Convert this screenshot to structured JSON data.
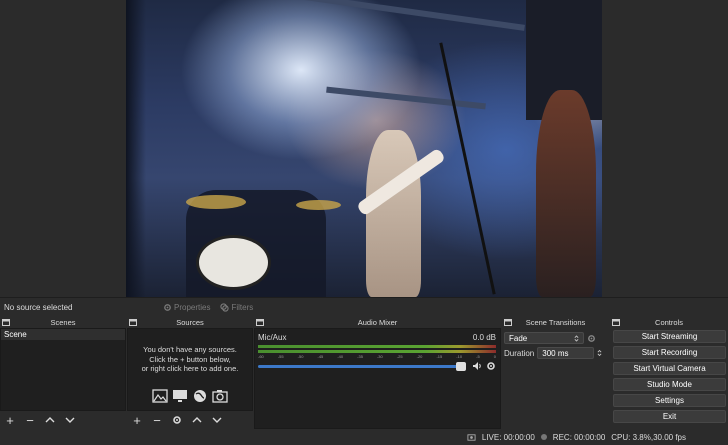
{
  "preview": {
    "scene_caption": ""
  },
  "source_bar": {
    "no_source": "No source selected",
    "properties_label": "Properties",
    "filters_label": "Filters"
  },
  "docks": {
    "scenes": {
      "title": "Scenes",
      "items": [
        "Scene"
      ]
    },
    "sources": {
      "title": "Sources",
      "empty_line1": "You don't have any sources.",
      "empty_line2": "Click the + button below,",
      "empty_line3": "or right click here to add one."
    },
    "mixer": {
      "title": "Audio Mixer",
      "channel_name": "Mic/Aux",
      "channel_db": "0.0 dB",
      "scale": [
        "-60",
        "-55",
        "-50",
        "-45",
        "-40",
        "-35",
        "-30",
        "-25",
        "-20",
        "-15",
        "-10",
        "-5",
        "0"
      ]
    },
    "transitions": {
      "title": "Scene Transitions",
      "selected": "Fade",
      "duration_label": "Duration",
      "duration_value": "300 ms"
    },
    "controls": {
      "title": "Controls",
      "buttons": [
        "Start Streaming",
        "Start Recording",
        "Start Virtual Camera",
        "Studio Mode",
        "Settings",
        "Exit"
      ]
    }
  },
  "status": {
    "live": "LIVE: 00:00:00",
    "rec": "REC: 00:00:00",
    "cpu": "CPU: 3.8%,30.00 fps"
  },
  "colors": {
    "background": "#2b2b2b",
    "panel": "#1f1f1f",
    "fader": "#3c78c8",
    "meter_green": "#5aa332"
  }
}
